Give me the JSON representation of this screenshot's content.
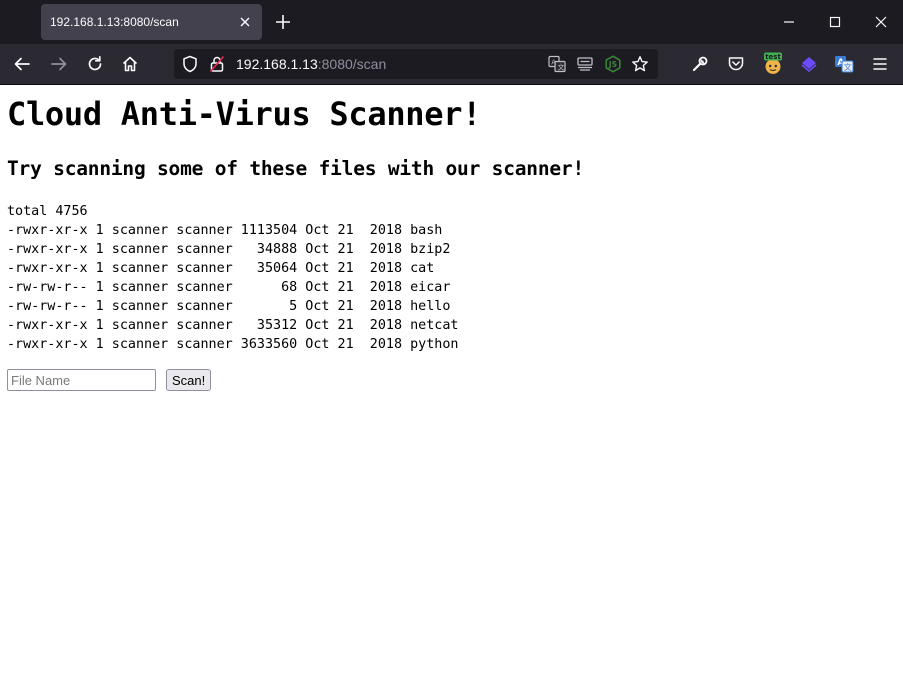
{
  "browser": {
    "tab": {
      "title": "192.168.1.13:8080/scan"
    },
    "url": {
      "host": "192.168.1.13",
      "rest": ":8080/scan"
    },
    "extension_badge": "test"
  },
  "page": {
    "heading": "Cloud Anti-Virus Scanner!",
    "subheading": "Try scanning some of these files with our scanner!",
    "listing": {
      "total": "total 4756",
      "rows": [
        "-rwxr-xr-x 1 scanner scanner 1113504 Oct 21  2018 bash",
        "-rwxr-xr-x 1 scanner scanner   34888 Oct 21  2018 bzip2",
        "-rwxr-xr-x 1 scanner scanner   35064 Oct 21  2018 cat",
        "-rw-rw-r-- 1 scanner scanner      68 Oct 21  2018 eicar",
        "-rw-rw-r-- 1 scanner scanner       5 Oct 21  2018 hello",
        "-rwxr-xr-x 1 scanner scanner   35312 Oct 21  2018 netcat",
        "-rwxr-xr-x 1 scanner scanner 3633560 Oct 21  2018 python"
      ]
    },
    "form": {
      "file_name_value": "",
      "file_name_placeholder": "File Name",
      "submit_label": "Scan!"
    }
  },
  "colors": {
    "titlebar": "#1c1b22",
    "tab_active": "#42414d",
    "navbar": "#2b2a33",
    "urlbar": "#1c1b22",
    "insecure_lock": "#e22850",
    "node_ext": "#3c873a",
    "proton_ext": "#6d4aff",
    "translate_ext": "#3a7bd5"
  }
}
